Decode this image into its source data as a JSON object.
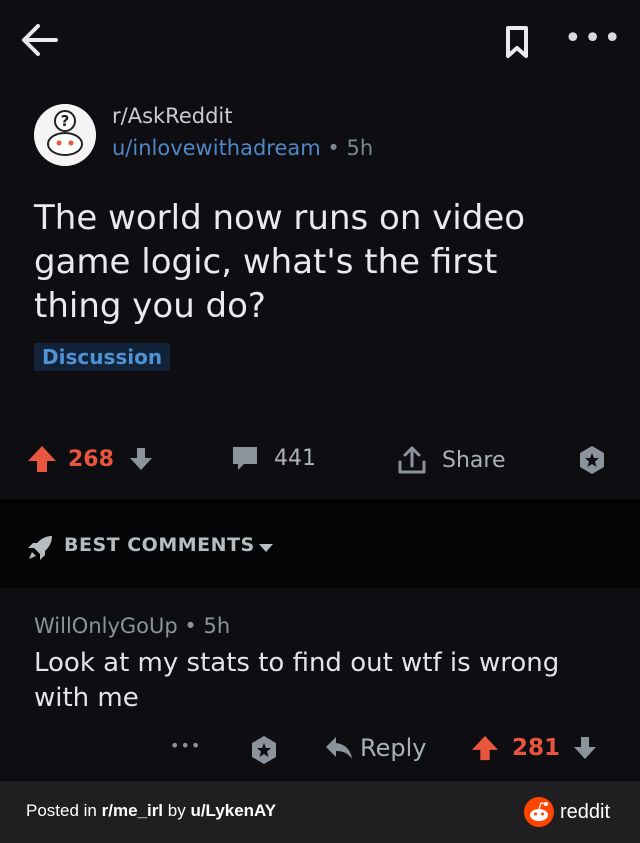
{
  "topbar": {
    "back_icon": "arrow-left-icon",
    "bookmark_icon": "bookmark-icon",
    "more_label": "•••"
  },
  "post": {
    "subreddit": "r/AskReddit",
    "author": "u/inlovewithadream",
    "time": "• 5h",
    "title": "The world now runs on video game logic, what's the first thing you do?",
    "flair": "Discussion",
    "upvotes": "268",
    "comments": "441",
    "share_label": "Share"
  },
  "sort": {
    "label": "BEST COMMENTS"
  },
  "comment": {
    "author": "WillOnlyGoUp",
    "time": "• 5h",
    "body": "Look at my stats to find out wtf is wrong with me",
    "more_label": "•••",
    "reply_label": "Reply",
    "score": "281"
  },
  "footer": {
    "prefix": "Posted in ",
    "subreddit": "r/me_irl",
    "by": " by ",
    "user": "u/LykenAY",
    "brand": "reddit"
  },
  "colors": {
    "upvote": "#e8563f",
    "link_blue": "#4f88c6",
    "background": "#0d0d12",
    "reddit_orange": "#ff4500"
  }
}
